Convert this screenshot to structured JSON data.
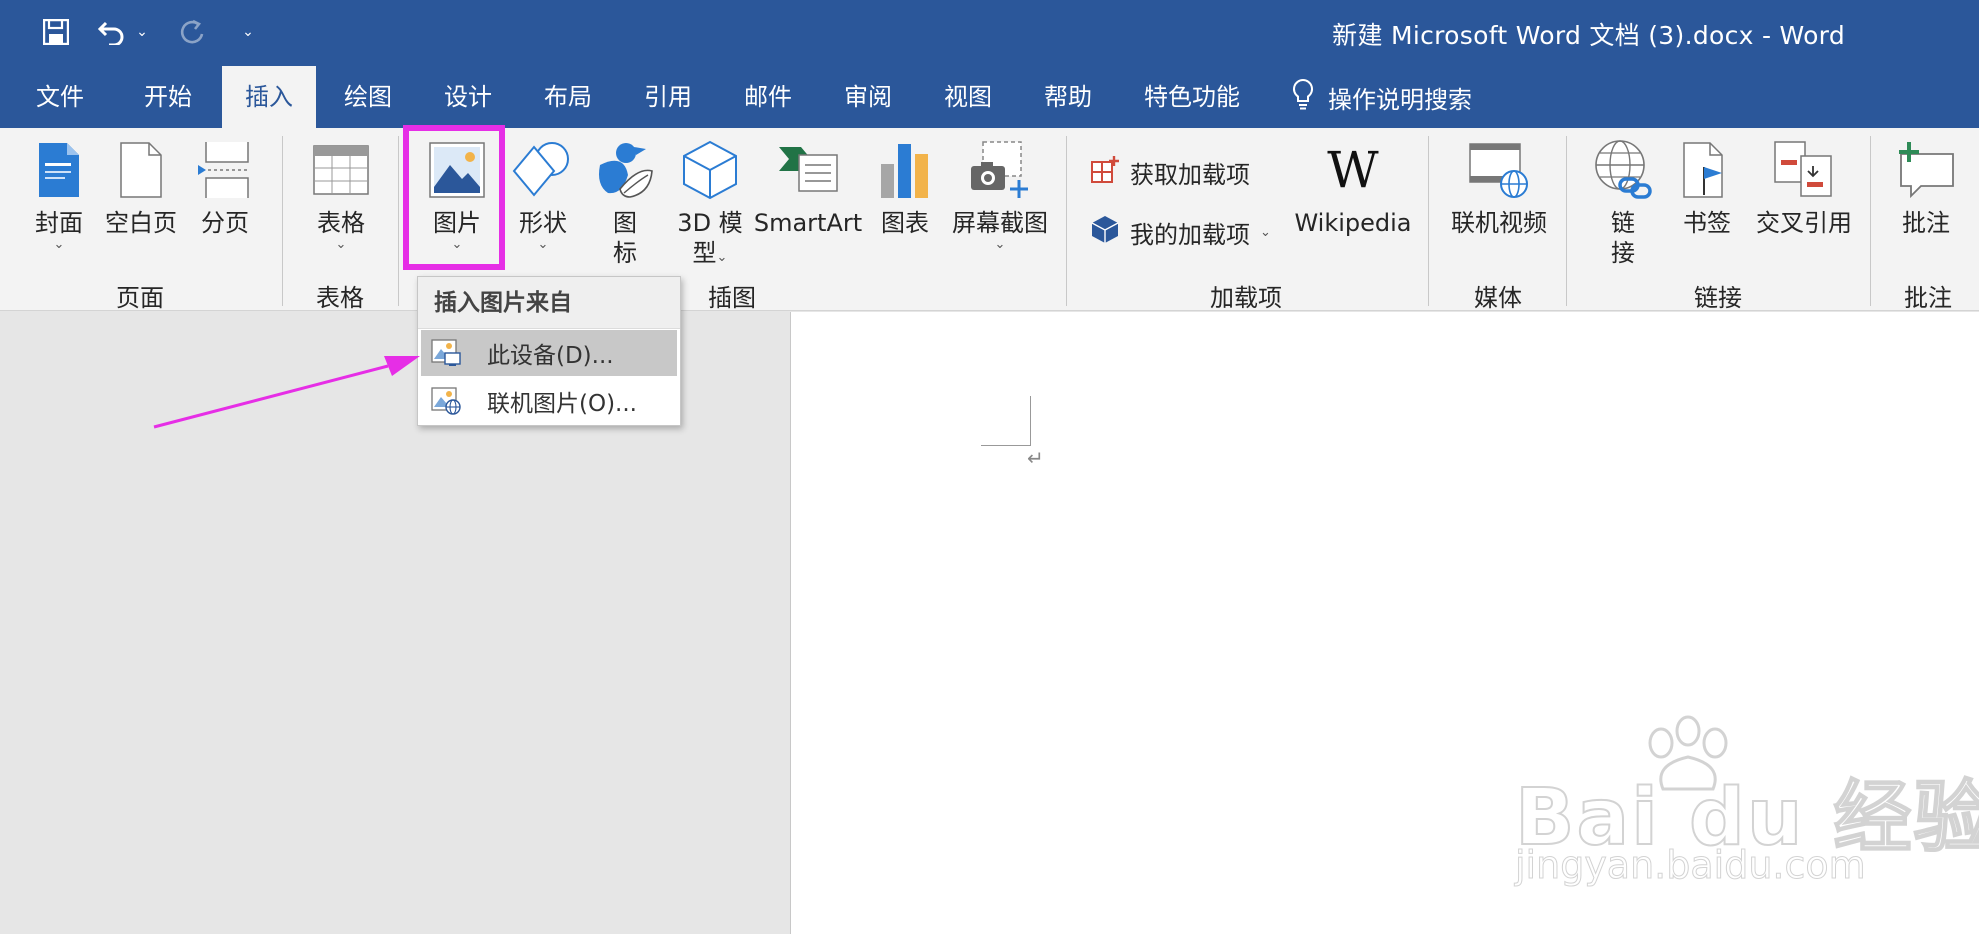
{
  "window": {
    "title": "新建 Microsoft Word 文档 (3).docx  -  Word",
    "quick_access": {
      "save_icon": "save-icon",
      "undo_icon": "undo-icon",
      "undo_dropdown": "⌄",
      "redo_icon": "redo-icon",
      "customize": "⌄"
    }
  },
  "tabs": [
    {
      "label": "文件"
    },
    {
      "label": "开始"
    },
    {
      "label": "插入",
      "active": true
    },
    {
      "label": "绘图"
    },
    {
      "label": "设计"
    },
    {
      "label": "布局"
    },
    {
      "label": "引用"
    },
    {
      "label": "邮件"
    },
    {
      "label": "审阅"
    },
    {
      "label": "视图"
    },
    {
      "label": "帮助"
    },
    {
      "label": "特色功能"
    }
  ],
  "tell_me": {
    "label": "操作说明搜索",
    "icon": "lightbulb-icon"
  },
  "ribbon": {
    "groups": {
      "pages": {
        "label": "页面",
        "cover": "封面",
        "blank": "空白页",
        "break": "分页",
        "dd": "⌄"
      },
      "table": {
        "label": "表格",
        "table": "表格",
        "dd": "⌄"
      },
      "illustrations": {
        "label": "插图",
        "pictures": "图片",
        "shapes": "形状",
        "icons_line1": "图",
        "icons_line2": "标",
        "model3d_line1": "3D 模",
        "model3d_line2": "型",
        "smartart": "SmartArt",
        "chart": "图表",
        "screenshot": "屏幕截图",
        "dd": "⌄"
      },
      "addins": {
        "label": "加载项",
        "get_addins": "获取加载项",
        "my_addins": "我的加载项",
        "wikipedia": "Wikipedia",
        "wiki_logo": "W",
        "dd": "⌄"
      },
      "media": {
        "label": "媒体",
        "online_video": "联机视频"
      },
      "links": {
        "label": "链接",
        "link_line1": "链",
        "link_line2": "接",
        "bookmark": "书签",
        "cross_ref": "交叉引用"
      },
      "comments": {
        "label": "批注",
        "comment": "批注"
      }
    }
  },
  "dropdown": {
    "header": "插入图片来自",
    "items": [
      {
        "label": "此设备(D)...",
        "icon": "device-picture-icon",
        "highlighted": true
      },
      {
        "label": "联机图片(O)...",
        "icon": "online-picture-icon"
      }
    ]
  },
  "document": {
    "paragraph_mark": "↵"
  },
  "watermark": {
    "main": "Bai du 经验",
    "sub": "jingyan.baidu.com"
  },
  "colors": {
    "title_bar": "#2b579a",
    "ribbon": "#f3f3f3",
    "annotation": "#e62ee6"
  }
}
